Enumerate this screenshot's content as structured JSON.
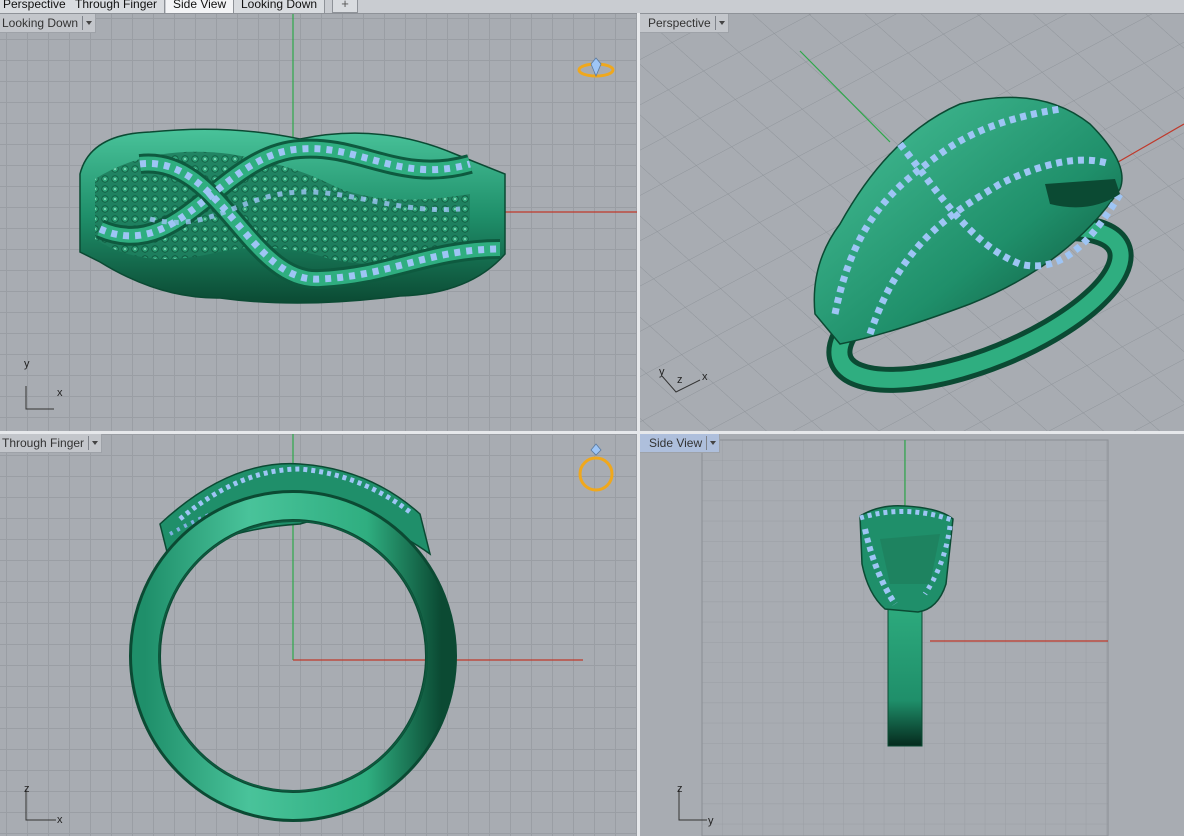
{
  "tabs": [
    {
      "label": "Perspective",
      "active": false
    },
    {
      "label": "Through Finger",
      "active": false
    },
    {
      "label": "Side View",
      "active": true
    },
    {
      "label": "Looking Down",
      "active": false
    }
  ],
  "tab_add_icon": "plus-icon",
  "viewports": {
    "top_left": {
      "title": "Looking Down",
      "axis_a": "y",
      "axis_b": "x"
    },
    "top_right": {
      "title": "Perspective",
      "axis_a": "y",
      "axis_b": "x",
      "axis_c": "z"
    },
    "bottom_left": {
      "title": "Through Finger",
      "axis_a": "z",
      "axis_b": "x"
    },
    "bottom_right": {
      "title": "Side View",
      "axis_a": "z",
      "axis_b": "y"
    }
  },
  "colors": {
    "metal": "#1f8f6a",
    "metal_dark": "#0b4a33",
    "metal_light": "#49c39a",
    "stone": "#9ec5f5",
    "stone_bright": "#e4f2ff",
    "axis_x": "#c0392b",
    "axis_y": "#2ea84a",
    "gumball_icon": "#f0a81c"
  }
}
